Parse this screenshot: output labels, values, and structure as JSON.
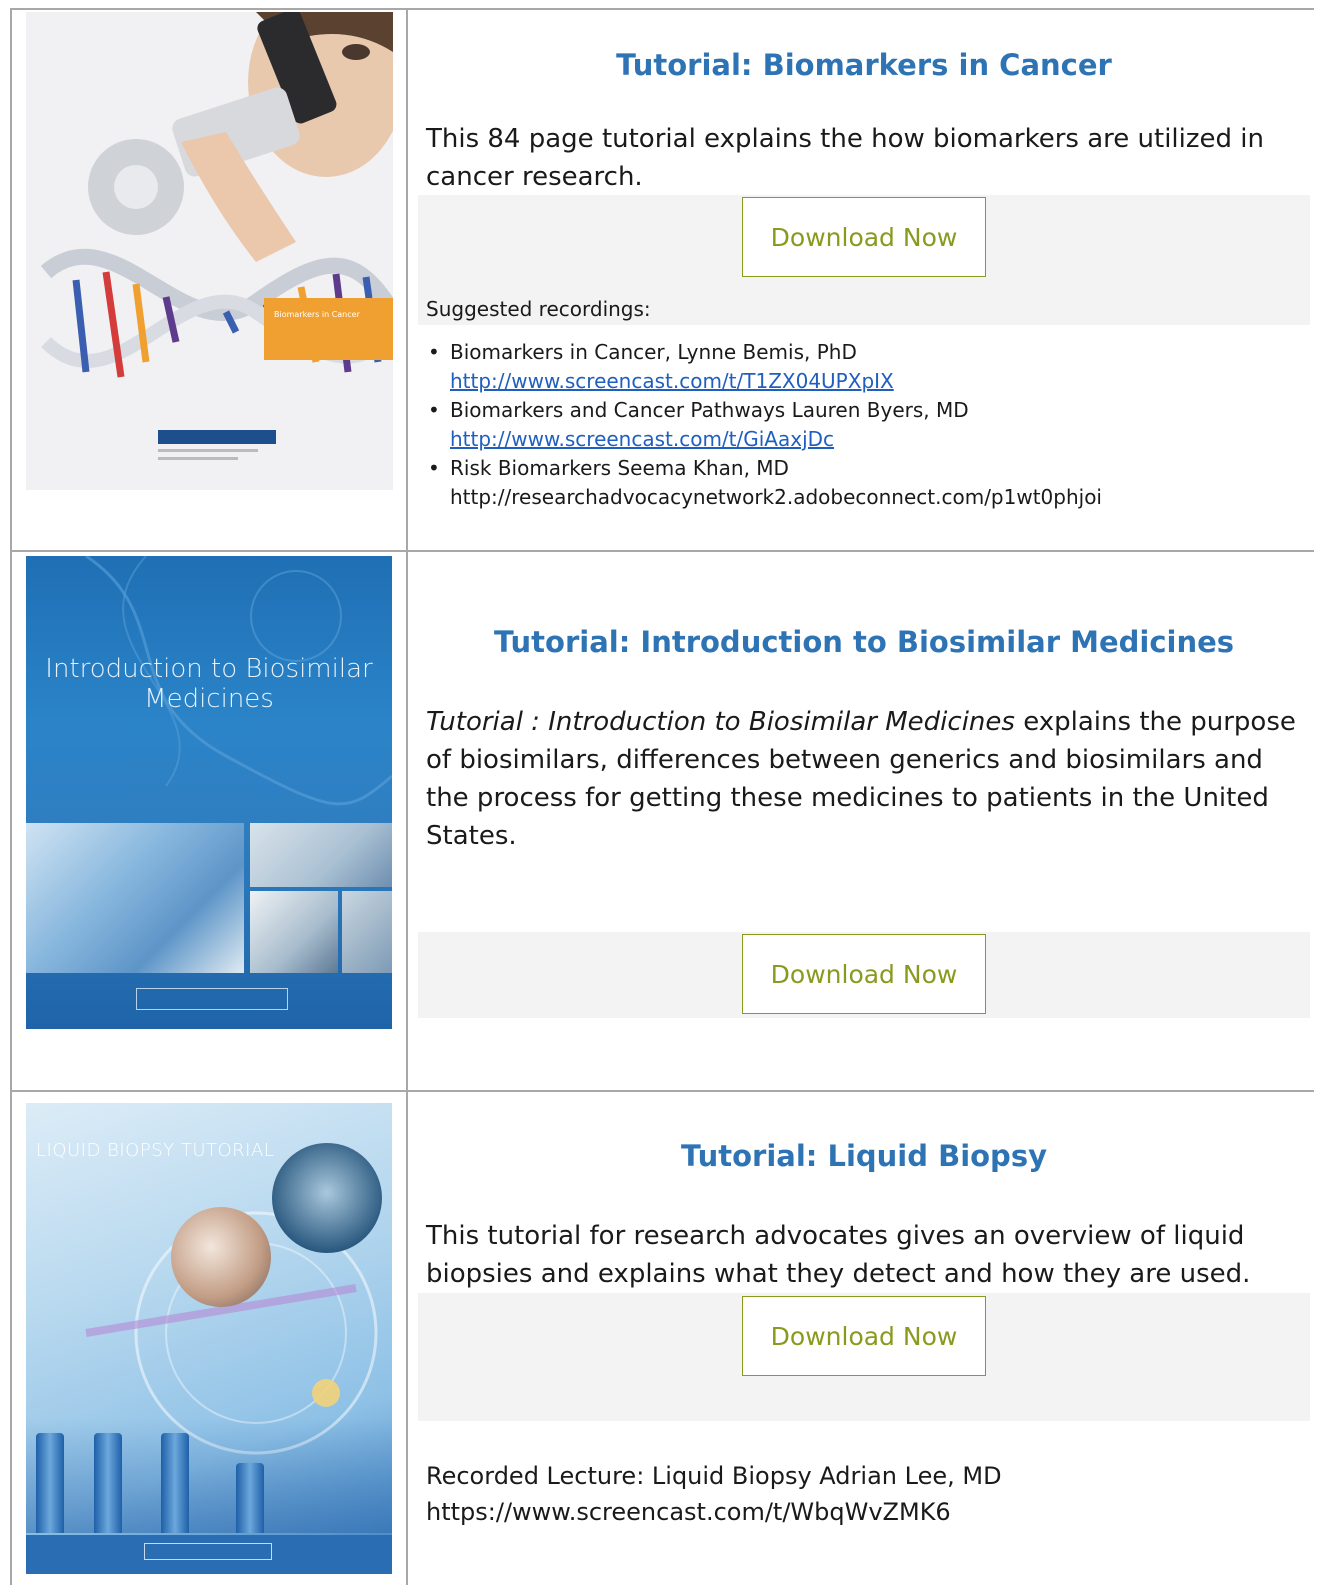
{
  "sections": [
    {
      "title": "Tutorial: Biomarkers in Cancer",
      "description": "This 84 page tutorial explains the how biomarkers are utilized in cancer research.",
      "download_label": "Download Now",
      "suggested_label": "Suggested recordings:",
      "recordings": [
        {
          "text": "Biomarkers in Cancer, Lynne Bemis, PhD",
          "url": "http://www.screencast.com/t/T1ZX04UPXpIX"
        },
        {
          "text": "Biomarkers and Cancer Pathways Lauren Byers, MD",
          "url": "http://www.screencast.com/t/GiAaxjDc"
        },
        {
          "text": "Risk Biomarkers Seema Khan, MD",
          "url": "http://researchadvocacynetwork2.adobeconnect.com/p1wt0phjoi"
        }
      ],
      "cover_text": "Biomarkers in Cancer"
    },
    {
      "title": "Tutorial: Introduction to Biosimilar Medicines",
      "description_italic": "Tutorial : Introduction to Biosimilar Medicines",
      "description_rest": " explains the purpose of biosimilars, differences between generics and biosimilars and the process for getting these medicines to patients in the United States.",
      "download_label": "Download Now",
      "cover_title": "Introduction to Biosimilar Medicines"
    },
    {
      "title": "Tutorial: Liquid Biopsy",
      "description": "This tutorial for research advocates gives an overview of liquid biopsies and explains what they detect and how they are used.",
      "download_label": "Download Now",
      "lecture_label": "Recorded Lecture: Liquid Biopsy Adrian Lee, MD",
      "lecture_url": "https://www.screencast.com/t/WbqWvZMK6",
      "cover_title": "LIQUID BIOPSY TUTORIAL"
    }
  ],
  "colors": {
    "title": "#2e74b5",
    "link": "#1f5fbf",
    "button": "#8a9a1e",
    "band": "#f3f3f3",
    "grid": "#a8a8a8"
  }
}
